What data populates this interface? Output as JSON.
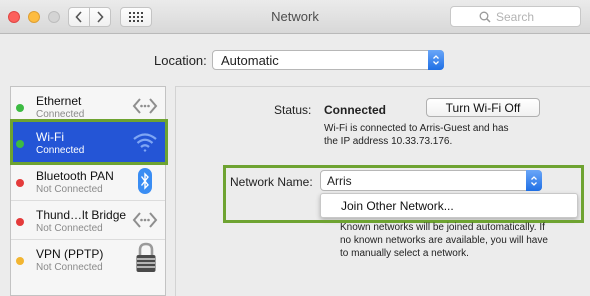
{
  "window": {
    "title": "Network"
  },
  "search": {
    "placeholder": "Search"
  },
  "location": {
    "label": "Location:",
    "value": "Automatic"
  },
  "services": [
    {
      "name": "Ethernet",
      "status": "Connected",
      "status_color": "#3dbb43",
      "icon": "ethernet-arrows-icon",
      "selected": false
    },
    {
      "name": "Wi-Fi",
      "status": "Connected",
      "status_color": "#3dbb43",
      "icon": "wifi-icon",
      "selected": true
    },
    {
      "name": "Bluetooth PAN",
      "status": "Not Connected",
      "status_color": "#e43b3b",
      "icon": "bluetooth-icon",
      "selected": false
    },
    {
      "name": "Thund…lt Bridge",
      "status": "Not Connected",
      "status_color": "#e43b3b",
      "icon": "thunderbolt-arrows-icon",
      "selected": false
    },
    {
      "name": "VPN (PPTP)",
      "status": "Not Connected",
      "status_color": "#f2b531",
      "icon": "lock-icon",
      "selected": false
    }
  ],
  "detail": {
    "status_label": "Status:",
    "status_value": "Connected",
    "turn_off_button": "Turn Wi-Fi Off",
    "status_desc_line1": "Wi-Fi is connected to Arris-Guest and has",
    "status_desc_line2": "the IP address 10.33.73.176.",
    "network_name_label": "Network Name:",
    "network_name_value": "Arris",
    "menu_item": "Join Other Network...",
    "known_line1": "Known networks will be joined automatically. If",
    "known_line2": "no known networks are available, you will have",
    "known_line3": "to manually select a network."
  },
  "colors": {
    "selection": "#2455d6",
    "highlight_box": "#6ea331",
    "stepper": "#1f6fe5",
    "traffic_close": "#fc605c",
    "traffic_minimize": "#fdbc40",
    "traffic_zoom": "#d4d4d4"
  }
}
